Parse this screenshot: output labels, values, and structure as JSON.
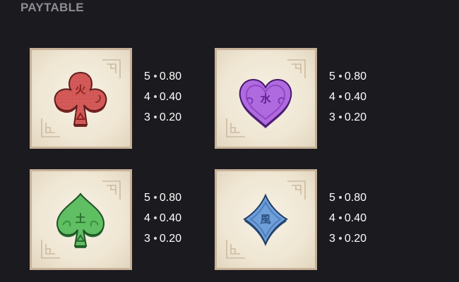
{
  "header": {
    "title": "PAYTABLE"
  },
  "symbols": [
    {
      "icon": "red-club-fire-icon",
      "glyph": "火",
      "colors": {
        "fill": "#d35a58",
        "dark": "#7d2626",
        "glyph": "#8a2222"
      },
      "pays": [
        {
          "count": "5",
          "value": "0.80"
        },
        {
          "count": "4",
          "value": "0.40"
        },
        {
          "count": "3",
          "value": "0.20"
        }
      ]
    },
    {
      "icon": "purple-heart-water-icon",
      "glyph": "水",
      "colors": {
        "fill": "#b06ae0",
        "dark": "#5d2a86",
        "glyph": "#5c2389"
      },
      "pays": [
        {
          "count": "5",
          "value": "0.80"
        },
        {
          "count": "4",
          "value": "0.40"
        },
        {
          "count": "3",
          "value": "0.20"
        }
      ]
    },
    {
      "icon": "green-spade-earth-icon",
      "glyph": "土",
      "colors": {
        "fill": "#5fbf62",
        "dark": "#2b6d33",
        "glyph": "#2a6b2f"
      },
      "pays": [
        {
          "count": "5",
          "value": "0.80"
        },
        {
          "count": "4",
          "value": "0.40"
        },
        {
          "count": "3",
          "value": "0.20"
        }
      ]
    },
    {
      "icon": "blue-diamond-wind-icon",
      "glyph": "風",
      "colors": {
        "fill": "#6f9fd8",
        "dark": "#2f5587",
        "glyph": "#2d5285"
      },
      "pays": [
        {
          "count": "5",
          "value": "0.80"
        },
        {
          "count": "4",
          "value": "0.40"
        },
        {
          "count": "3",
          "value": "0.20"
        }
      ]
    }
  ]
}
